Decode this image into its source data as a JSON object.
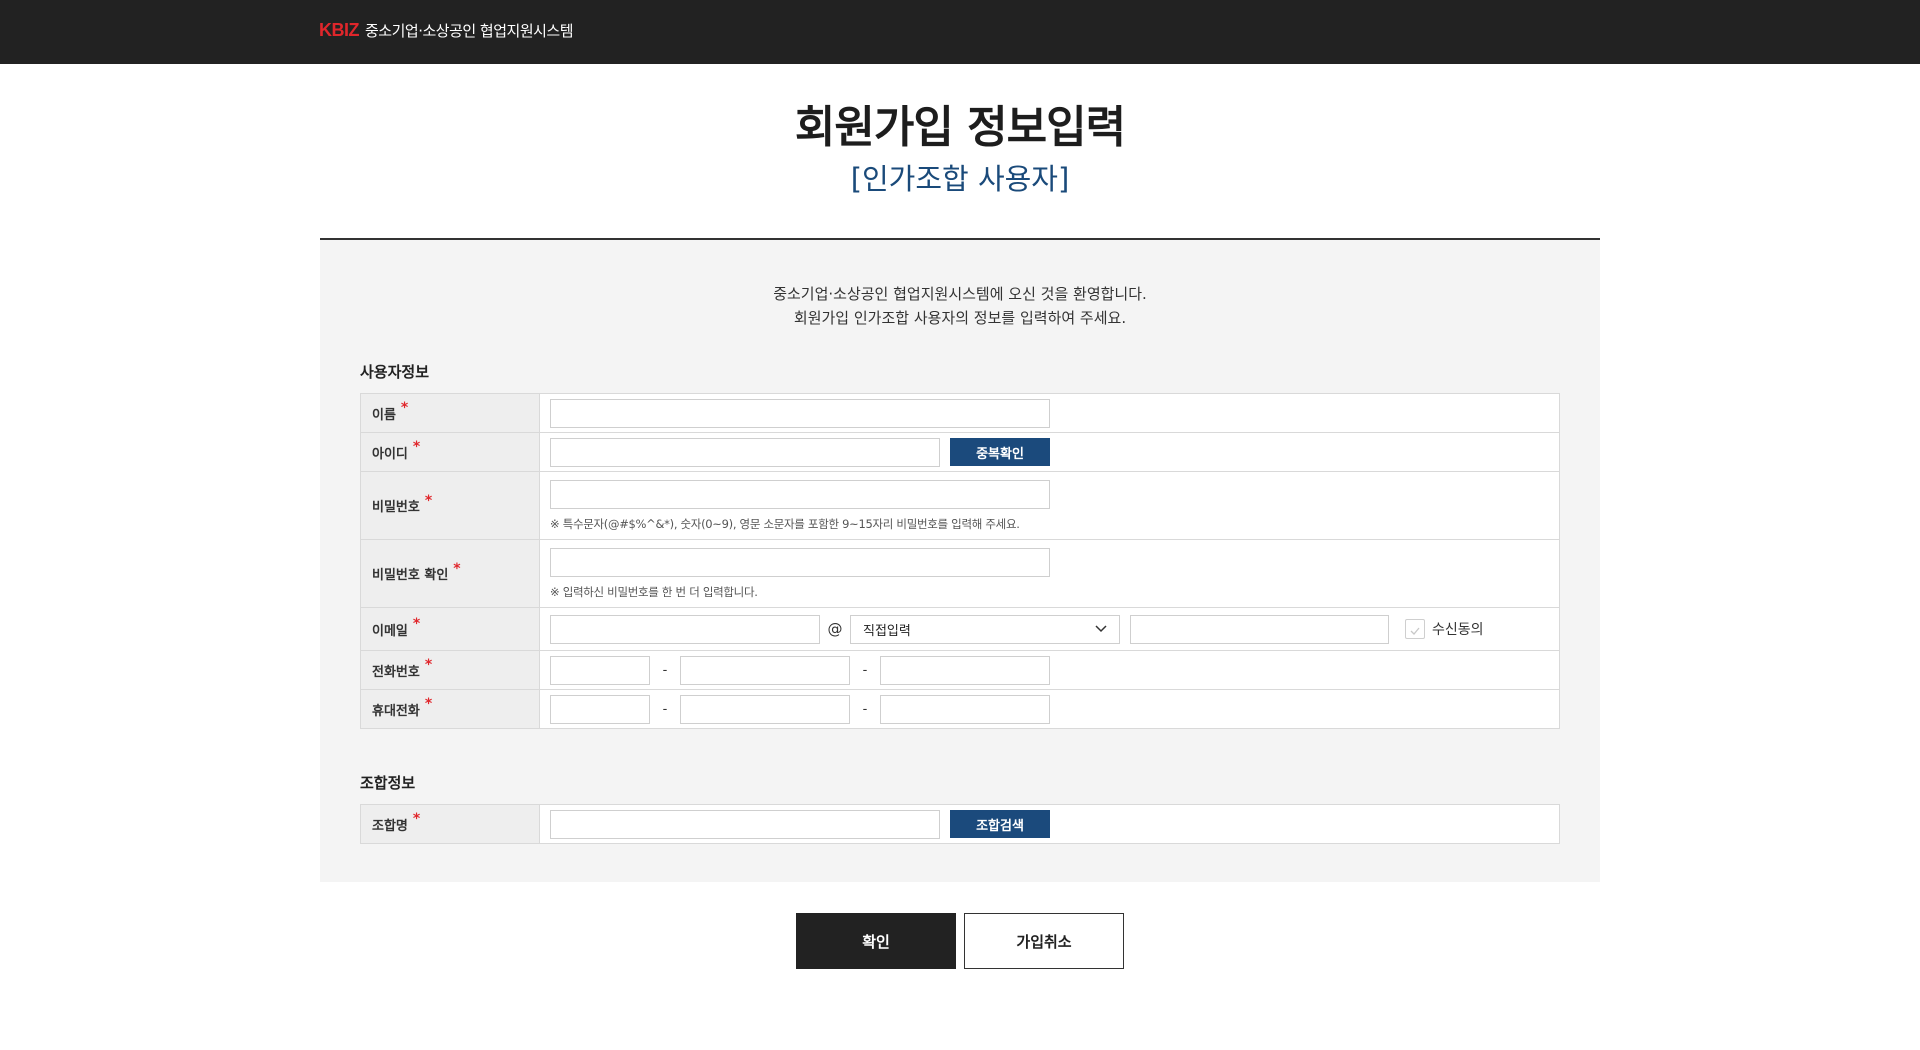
{
  "header": {
    "logo_text": "KBIZ",
    "system_name": "중소기업·소상공인 협업지원시스템"
  },
  "page": {
    "title": "회원가입 정보입력",
    "subtitle": "[인가조합 사용자]",
    "welcome_line1": "중소기업·소상공인 협업지원시스템에 오신 것을 환영합니다.",
    "welcome_line2": "회원가입 인가조합 사용자의 정보를 입력하여 주세요."
  },
  "user_section": {
    "title": "사용자정보",
    "required_mark": "*",
    "fields": {
      "name": {
        "label": "이름",
        "value": ""
      },
      "id": {
        "label": "아이디",
        "value": "",
        "check_button": "중복확인"
      },
      "password": {
        "label": "비밀번호",
        "value": "",
        "hint": "※ 특수문자(@#$%^&*), 숫자(0~9), 영문 소문자를 포함한 9~15자리 비밀번호를 입력해 주세요."
      },
      "password_confirm": {
        "label": "비밀번호 확인",
        "value": "",
        "hint": "※ 입력하신 비밀번호를 한 번 더 입력합니다."
      },
      "email": {
        "label": "이메일",
        "local_value": "",
        "at": "@",
        "domain_select": "직접입력",
        "domain_value": "",
        "consent_label": "수신동의",
        "consent_checked": false
      },
      "phone": {
        "label": "전화번호",
        "part1": "",
        "part2": "",
        "part3": "",
        "separator": "-"
      },
      "mobile": {
        "label": "휴대전화",
        "part1": "",
        "part2": "",
        "part3": "",
        "separator": "-"
      }
    }
  },
  "union_section": {
    "title": "조합정보",
    "fields": {
      "union_name": {
        "label": "조합명",
        "value": "",
        "search_button": "조합검색"
      }
    }
  },
  "actions": {
    "confirm": "확인",
    "cancel": "가입취소"
  },
  "colors": {
    "topbar": "#222222",
    "brand_red": "#e0262b",
    "accent_blue": "#1b4a7c",
    "subtitle_blue": "#1a4a7a",
    "panel_bg": "#f4f4f4"
  }
}
